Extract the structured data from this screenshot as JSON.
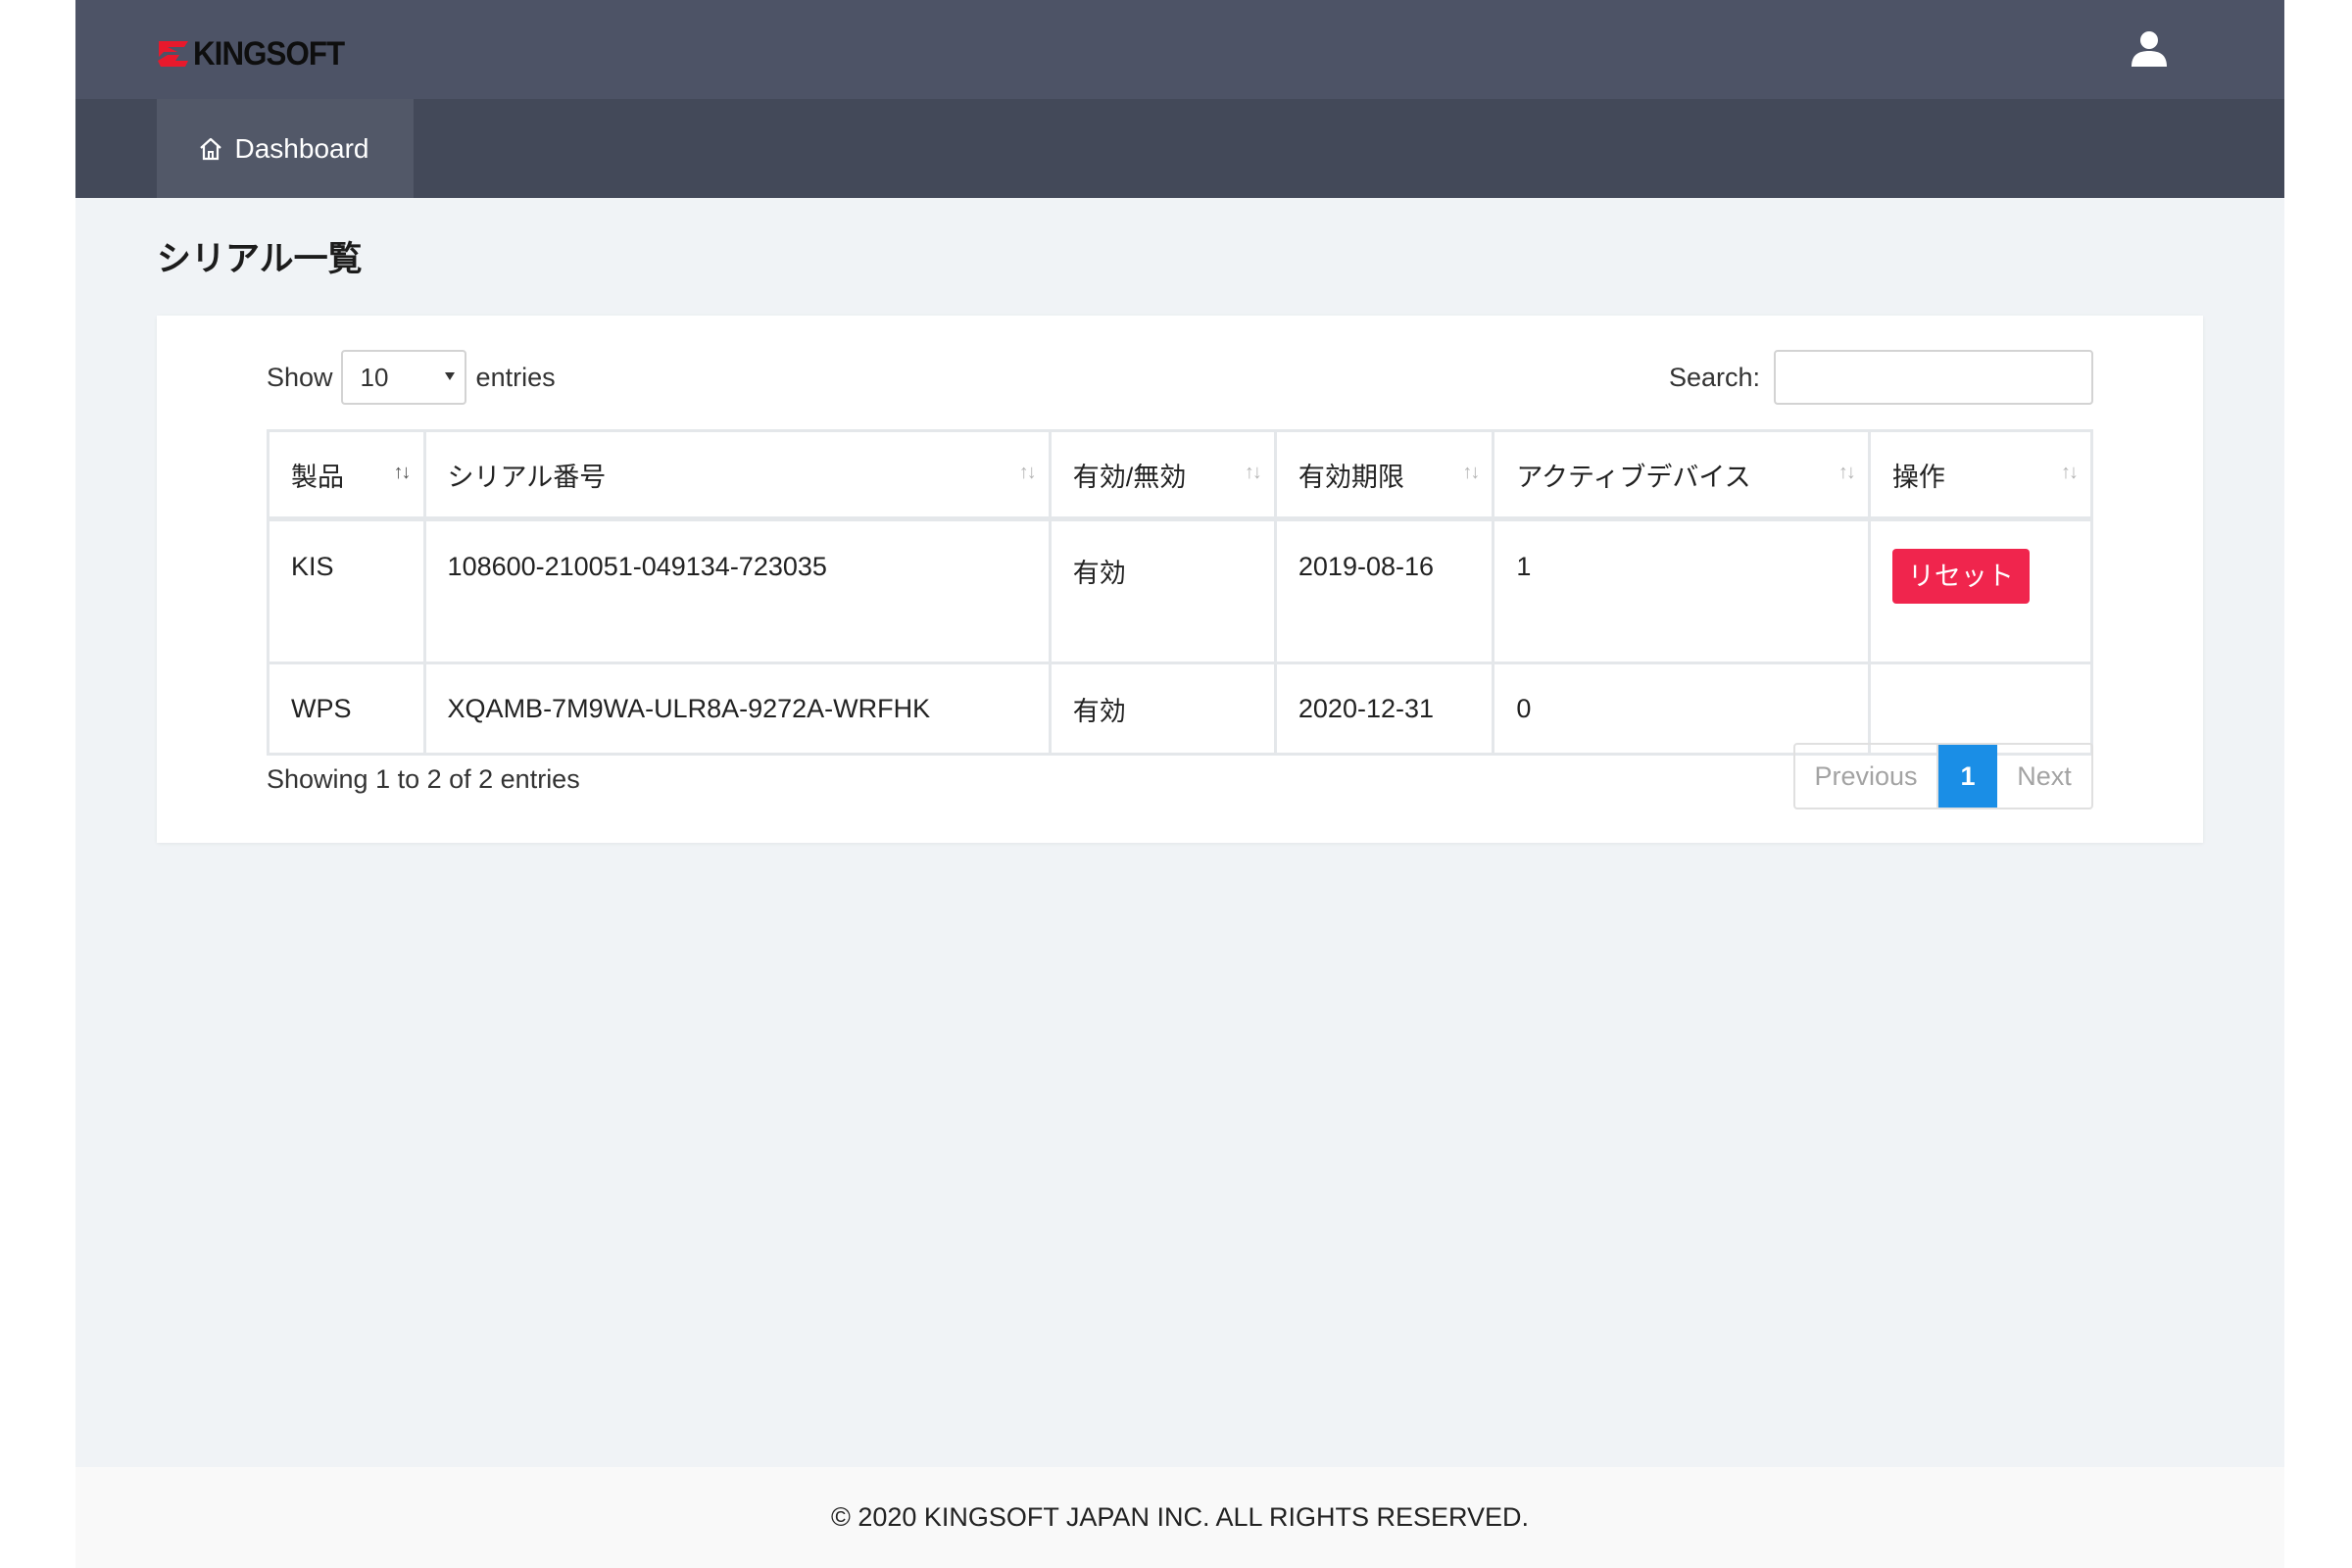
{
  "header": {
    "logo_text": "KINGSOFT",
    "brand_color": "#e8192c",
    "user_icon": "user-icon"
  },
  "nav": {
    "items": [
      {
        "label": "Dashboard",
        "icon": "home-icon",
        "active": true
      }
    ]
  },
  "page": {
    "title": "シリアル一覧"
  },
  "table_controls": {
    "show_label": "Show",
    "length_value": "10",
    "entries_label": "entries",
    "search_label": "Search:",
    "search_value": ""
  },
  "table": {
    "columns": [
      "製品",
      "シリアル番号",
      "有効/無効",
      "有効期限",
      "アクティブデバイス",
      "操作"
    ],
    "sort_icon": "↑↓",
    "rows": [
      {
        "product": "KIS",
        "serial": "108600-210051-049134-723035",
        "status": "有効",
        "expiry": "2019-08-16",
        "active_devices": "1",
        "action_label": "リセット"
      },
      {
        "product": "WPS",
        "serial": "XQAMB-7M9WA-ULR8A-9272A-WRFHK",
        "status": "有効",
        "expiry": "2020-12-31",
        "active_devices": "0",
        "action_label": ""
      }
    ]
  },
  "table_info": "Showing 1 to 2 of 2 entries",
  "pagination": {
    "previous": "Previous",
    "current": "1",
    "next": "Next",
    "active_color": "#1a8ee6"
  },
  "action_color": "#f0254d",
  "footer": {
    "copyright": "© 2020 KINGSOFT JAPAN INC. ALL RIGHTS RESERVED."
  }
}
